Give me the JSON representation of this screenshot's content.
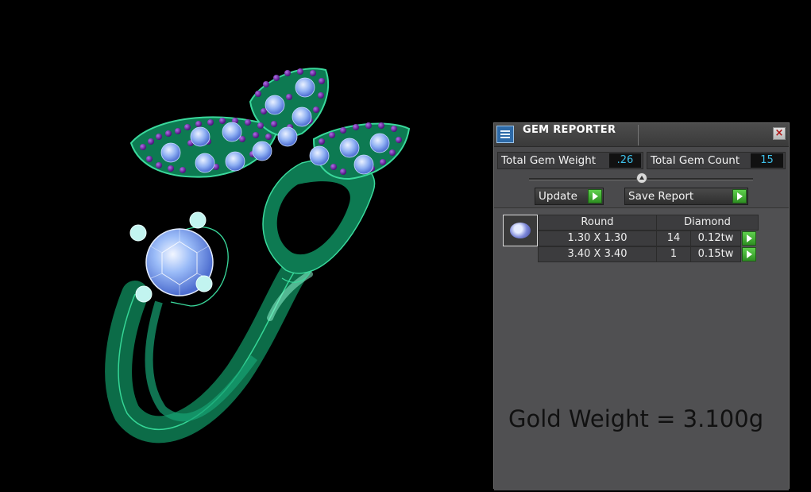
{
  "viewport": {
    "model": "ring-3d-model",
    "colors": {
      "metal": "#0f7a52",
      "metal_edge": "#3ad99c",
      "gem": "#8fb4f7",
      "pave_bead": "#6a1fa3",
      "prong": "#c2f4f0"
    }
  },
  "panel": {
    "title": "GEM REPORTER",
    "app_icon": "report-icon",
    "close_icon": "close-icon",
    "total_gem_weight": {
      "label": "Total Gem Weight",
      "value": ".26"
    },
    "total_gem_count": {
      "label": "Total Gem Count",
      "value": "15"
    },
    "buttons": {
      "update": "Update",
      "save_report": "Save Report"
    },
    "table": {
      "shape": "Round",
      "material": "Diamond",
      "rows": [
        {
          "size": "1.30 X 1.30",
          "count": "14",
          "weight": "0.12tw"
        },
        {
          "size": "3.40 X 3.40",
          "count": "1",
          "weight": "0.15tw"
        }
      ]
    },
    "gold_weight": "Gold Weight = 3.100g",
    "colors": {
      "value_text": "#3ec0ea",
      "play_button": "#3fb030"
    }
  }
}
